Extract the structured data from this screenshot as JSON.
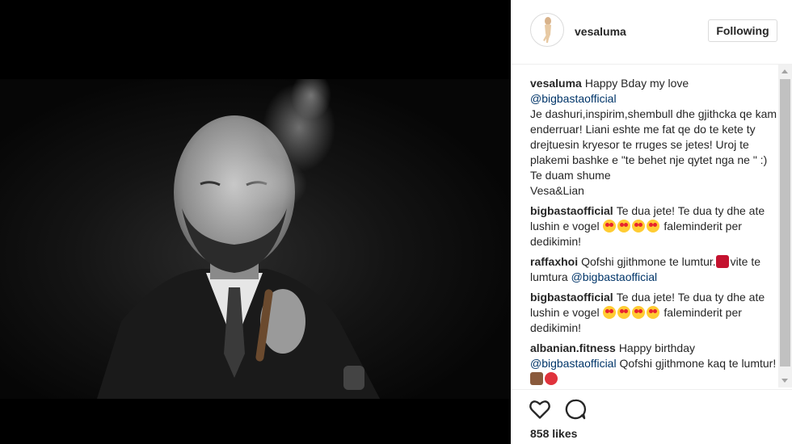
{
  "post": {
    "username": "vesaluma",
    "follow_label": "Following",
    "likes": "858 likes"
  },
  "comments": [
    {
      "user": "vesaluma",
      "line1": "Happy Bday my love",
      "mention": "@bigbastaofficial",
      "body": "Je dashuri,inspirim,shembull dhe gjithcka qe kam enderruar! Liani eshte me fat qe do te kete ty drejtuesin kryesor te rruges se jetes! Uroj te plakemi bashke e \"te behet nje qytet nga ne \" :) Te duam shume",
      "signature": "Vesa&Lian"
    },
    {
      "user": "bigbastaofficial",
      "text": "Te dua jete! Te dua ty dhe ate lushin e vogel",
      "after_emoji": "faleminderit per dedikimin!"
    },
    {
      "user": "raffaxhoi",
      "text": "Qofshi gjithmone te lumtur.",
      "after_emoji": "vite te lumtura",
      "mention": "@bigbastaofficial"
    },
    {
      "user": "bigbastaofficial",
      "text": "Te dua jete! Te dua ty dhe ate lushin e vogel",
      "after_emoji": "faleminderit per dedikimin!"
    },
    {
      "user": "albanian.fitness",
      "text": "Happy birthday",
      "mention": "@bigbastaofficial",
      "after_mention": "Qofshi gjithmone kaq te lumtur!"
    }
  ],
  "icons": {
    "like": "heart-outline-icon",
    "comment": "speech-bubble-icon"
  },
  "colors": {
    "mention": "#003569",
    "text": "#262626",
    "border": "#dbdbdb"
  }
}
